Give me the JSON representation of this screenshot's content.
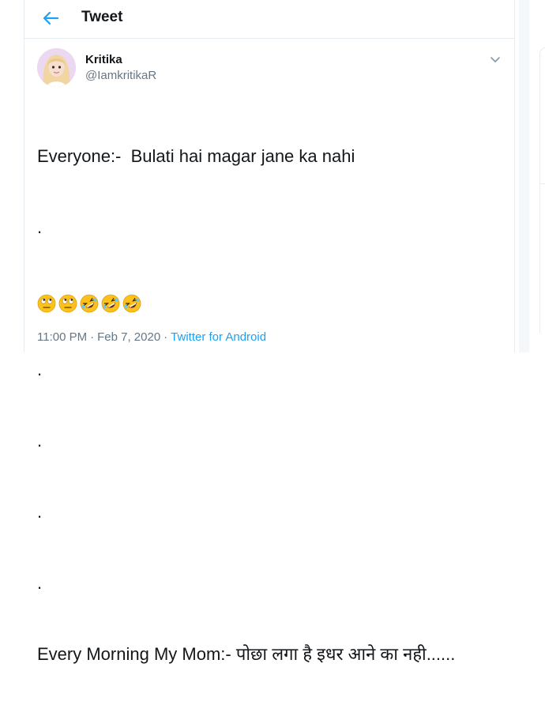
{
  "header": {
    "title": "Tweet"
  },
  "tweet": {
    "author": {
      "display_name": "Kritika",
      "handle": "@IamkritikaR"
    },
    "lines": [
      "Everyone:-  Bulati hai magar jane ka nahi",
      ".",
      ".",
      ".",
      ".",
      ".",
      ".",
      "Every Morning My Mom:- पोछा लगा है इधर आने का नही......"
    ],
    "emojis": [
      "face-with-rolling-eyes",
      "face-with-rolling-eyes",
      "rolling-on-the-floor-laughing",
      "rolling-on-the-floor-laughing",
      "rolling-on-the-floor-laughing"
    ],
    "time": "11:00 PM",
    "separator": "·",
    "date": "Feb 7, 2020",
    "source": "Twitter for Android"
  },
  "colors": {
    "accent": "#1da1f2",
    "secondary_text": "#657786",
    "border": "#e6ecf0"
  }
}
